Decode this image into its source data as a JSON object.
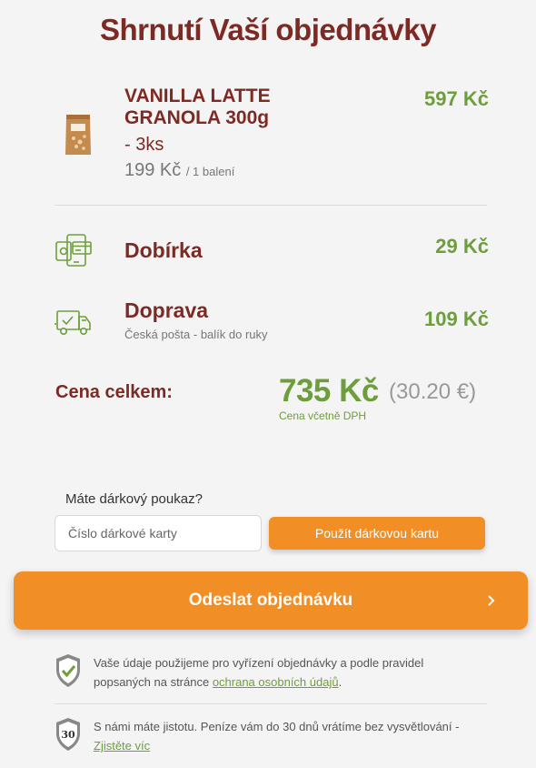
{
  "page": {
    "title": "Shrnutí Vaší objednávky"
  },
  "product": {
    "name": "VANILLA LATTE GRANOLA 300g",
    "quantity": "- 3ks",
    "unit_price": "199 Kč",
    "unit_note": "/ 1 balení",
    "price": "597 Kč",
    "thumb_icon": "granola-bag-icon"
  },
  "fees": [
    {
      "label": "Dobírka",
      "price": "29 Kč",
      "icon": "cash-on-delivery-icon"
    },
    {
      "label": "Doprava",
      "sub": "Česká pošta - balík do ruky",
      "price": "109 Kč",
      "icon": "delivery-truck-icon"
    }
  ],
  "total": {
    "label": "Cena celkem:",
    "value": "735 Kč",
    "eur": "(30.20 €)",
    "note": "Cena včetně DPH"
  },
  "voucher": {
    "question": "Máte dárkový poukaz?",
    "placeholder": "Číslo dárkové karty",
    "button": "Použít dárkovou kartu"
  },
  "submit": {
    "label": "Odeslat objednávku",
    "icon": "chevron-right-icon"
  },
  "privacy": {
    "text": "Vaše údaje použijeme pro vyřízení objednávky a podle pravidel popsaných na stránce ",
    "link": "ochrana osobních údajů",
    "tail": ".",
    "icon": "shield-check-icon"
  },
  "guarantee": {
    "text": "S námi máte jistotu. Peníze vám do 30 dnů vrátíme bez vysvětlování - ",
    "link": "Zjistěte víc",
    "badge": "30",
    "icon": "guarantee-shield-icon"
  },
  "colors": {
    "title": "#7d2a24",
    "price": "#6e9e3b",
    "accent": "#f18e25",
    "background": "#f4f4f4"
  }
}
